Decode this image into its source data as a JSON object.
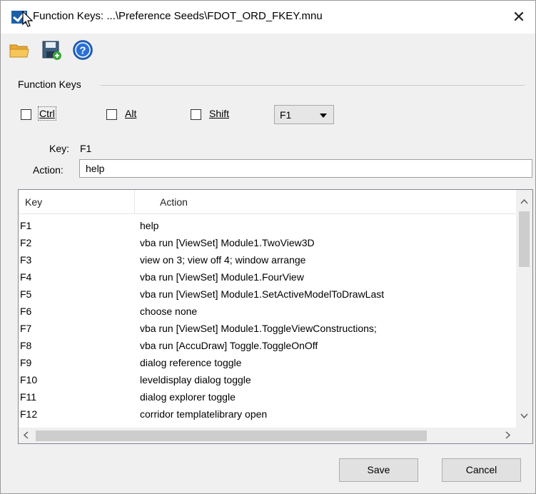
{
  "window": {
    "title": "Function Keys: ...\\Preference Seeds\\FDOT_ORD_FKEY.mnu",
    "close_glyph": "✕"
  },
  "toolbar": {
    "buttons": [
      {
        "icon": "folder-open-icon"
      },
      {
        "icon": "save-icon"
      },
      {
        "icon": "help-icon"
      }
    ]
  },
  "group": {
    "label": "Function Keys"
  },
  "modifiers": {
    "ctrl": {
      "label": "Ctrl",
      "checked": false
    },
    "alt": {
      "label": "Alt",
      "checked": false
    },
    "shift": {
      "label": "Shift",
      "checked": false
    }
  },
  "key_select": {
    "value": "F1"
  },
  "fields": {
    "key_label": "Key:",
    "key_value": "F1",
    "action_label": "Action:",
    "action_value": "help"
  },
  "table": {
    "columns": [
      "Key",
      "Action"
    ],
    "rows": [
      {
        "key": "F1",
        "action": "help"
      },
      {
        "key": "F2",
        "action": "vba run [ViewSet] Module1.TwoView3D"
      },
      {
        "key": "F3",
        "action": "view on 3; view off 4; window arrange"
      },
      {
        "key": "F4",
        "action": "vba run [ViewSet] Module1.FourView"
      },
      {
        "key": "F5",
        "action": "vba run [ViewSet] Module1.SetActiveModelToDrawLast"
      },
      {
        "key": "F6",
        "action": "choose none"
      },
      {
        "key": "F7",
        "action": "vba run [ViewSet] Module1.ToggleViewConstructions;"
      },
      {
        "key": "F8",
        "action": "vba run [AccuDraw] Toggle.ToggleOnOff"
      },
      {
        "key": "F9",
        "action": "dialog reference toggle"
      },
      {
        "key": "F10",
        "action": "leveldisplay dialog toggle"
      },
      {
        "key": "F11",
        "action": "dialog explorer toggle"
      },
      {
        "key": "F12",
        "action": "corridor templatelibrary open"
      }
    ]
  },
  "buttons": {
    "save_label": "Save",
    "cancel_label": "Cancel"
  }
}
